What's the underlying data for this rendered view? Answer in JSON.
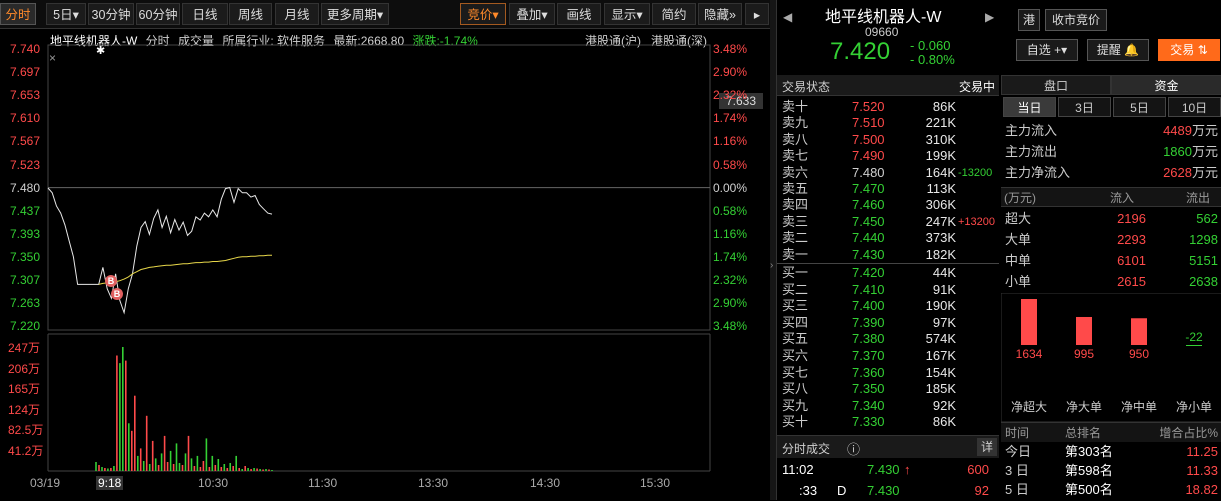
{
  "toolbar": {
    "tabs": [
      "分时",
      "5日",
      "30分钟",
      "60分钟",
      "日线",
      "周线",
      "月线",
      "更多周期"
    ],
    "dropdown_arrow": "▾",
    "right": [
      "竞价",
      "叠加",
      "画线",
      "显示",
      "简约",
      "隐藏"
    ],
    "expand": "»"
  },
  "chart": {
    "info": {
      "name": "地平线机器人-W",
      "mode": "分时",
      "volume": "成交量",
      "industry": "所属行业: 软件服务",
      "latest": "最新:2668.80",
      "change": "涨跌:-1.74%",
      "hk_sh": "港股通(沪)",
      "hk_sz": "港股通(深)"
    },
    "close_mark": "×",
    "star_mark": "✱",
    "y_price": [
      "7.740",
      "7.697",
      "7.653",
      "7.610",
      "7.567",
      "7.523",
      "7.480",
      "7.437",
      "7.393",
      "7.350",
      "7.307",
      "7.263",
      "7.220"
    ],
    "y_pct": [
      "3.48%",
      "2.90%",
      "2.32%",
      "1.74%",
      "1.16%",
      "0.58%",
      "0.00%",
      "0.58%",
      "1.16%",
      "1.74%",
      "2.32%",
      "2.90%",
      "3.48%"
    ],
    "cursor_price": "7.633",
    "y_vol": [
      "247万",
      "206万",
      "165万",
      "124万",
      "82.5万",
      "41.2万"
    ],
    "x_labels": [
      "03/19",
      "9:18",
      "10:30",
      "11:30",
      "13:30",
      "14:30",
      "15:30"
    ],
    "marker_b": "B",
    "chart_data": {
      "type": "line",
      "title": "",
      "ylim": [
        7.22,
        7.74
      ],
      "prev_close": 7.48,
      "series": [
        {
          "values": [
            7.479,
            7.47,
            7.445,
            7.432,
            7.41,
            7.38,
            7.35,
            7.298,
            7.298,
            7.298,
            7.298,
            7.298,
            7.298,
            7.33,
            7.29,
            7.272,
            7.318,
            7.268,
            7.245,
            7.29,
            7.318,
            7.37,
            7.405,
            7.416,
            7.392,
            7.422,
            7.438,
            7.405,
            7.426,
            7.395,
            7.42,
            7.4,
            7.415,
            7.39,
            7.398,
            7.425,
            7.419,
            7.432,
            7.425,
            7.438,
            7.425,
            7.458,
            7.478,
            7.48,
            7.452,
            7.478,
            7.47,
            7.47,
            7.462,
            7.465,
            7.448,
            7.44,
            7.432,
            7.43
          ]
        },
        {
          "values": [
            null,
            null,
            null,
            null,
            null,
            null,
            null,
            null,
            null,
            null,
            null,
            null,
            7.298,
            7.3,
            7.301,
            7.302,
            7.303,
            7.305,
            7.308,
            7.312,
            7.318,
            7.322,
            7.326,
            7.328,
            7.33,
            7.331,
            7.332,
            7.333,
            7.334,
            7.334,
            7.335,
            7.336,
            7.337,
            7.337,
            7.338,
            7.339,
            7.339,
            7.34,
            7.34,
            7.341,
            7.341,
            7.342,
            7.343,
            7.345,
            7.347,
            7.349,
            7.35,
            7.35,
            7.351,
            7.351,
            7.352,
            7.352,
            7.353,
            7.353
          ]
        }
      ],
      "volume": [
        18,
        12,
        8,
        6,
        5,
        6,
        10,
        230,
        215,
        247,
        220,
        95,
        80,
        150,
        30,
        45,
        20,
        110,
        14,
        60,
        25,
        12,
        35,
        70,
        18,
        40,
        14,
        55,
        16,
        12,
        35,
        70,
        25,
        10,
        30,
        8,
        20,
        65,
        8,
        30,
        12,
        24,
        8,
        14,
        6,
        16,
        10,
        30,
        6,
        4,
        10,
        6,
        4,
        6,
        5,
        4,
        3,
        4,
        3,
        2
      ],
      "volume_colors": [
        "#34d034",
        "#ff4a4a",
        "#34d034",
        "#ff4a4a",
        "#34d034",
        "#ff4a4a",
        "#34d034",
        "#ff4a4a",
        "#34d034",
        "#34d034",
        "#ff4a4a",
        "#34d034",
        "#ff4a4a",
        "#ff4a4a",
        "#34d034",
        "#ff4a4a",
        "#34d034",
        "#ff4a4a",
        "#34d034",
        "#ff4a4a",
        "#34d034",
        "#ff4a4a",
        "#34d034",
        "#ff4a4a",
        "#ff4a4a",
        "#34d034",
        "#ff4a4a",
        "#34d034",
        "#34d034",
        "#ff4a4a",
        "#34d034",
        "#ff4a4a",
        "#34d034",
        "#ff4a4a",
        "#34d034",
        "#ff4a4a",
        "#ff4a4a",
        "#34d034",
        "#ff4a4a",
        "#34d034",
        "#ff4a4a",
        "#34d034",
        "#ff4a4a",
        "#34d034",
        "#ff4a4a",
        "#34d034",
        "#ff4a4a",
        "#34d034",
        "#ff4a4a",
        "#34d034",
        "#ff4a4a",
        "#34d034",
        "#ff4a4a",
        "#34d034",
        "#ff4a4a",
        "#34d034",
        "#ff4a4a",
        "#34d034",
        "#ff4a4a",
        "#34d034"
      ]
    }
  },
  "stock": {
    "title": "地平线机器人-W",
    "code": "09660",
    "price": "7.420",
    "change": "- 0.060",
    "change_pct": "- 0.80%",
    "hk": "港",
    "auction": "收市竞价",
    "watch": "自选",
    "watch_plus": "+",
    "reminder": "提醒",
    "trade": "交易",
    "trade_icon": "⇅",
    "nav_prev": "◀",
    "nav_next": "▶"
  },
  "orderbook": {
    "status_label": "交易状态",
    "status": "交易中",
    "asks": [
      {
        "l": "卖十",
        "p": "7.520",
        "v": "86K",
        "c": ""
      },
      {
        "l": "卖九",
        "p": "7.510",
        "v": "221K",
        "c": ""
      },
      {
        "l": "卖八",
        "p": "7.500",
        "v": "310K",
        "c": ""
      },
      {
        "l": "卖七",
        "p": "7.490",
        "v": "199K",
        "c": ""
      },
      {
        "l": "卖六",
        "p": "7.480",
        "v": "164K",
        "c": "-13200"
      },
      {
        "l": "卖五",
        "p": "7.470",
        "v": "113K",
        "c": ""
      },
      {
        "l": "卖四",
        "p": "7.460",
        "v": "306K",
        "c": ""
      },
      {
        "l": "卖三",
        "p": "7.450",
        "v": "247K",
        "c": "+13200"
      },
      {
        "l": "卖二",
        "p": "7.440",
        "v": "373K",
        "c": ""
      },
      {
        "l": "卖一",
        "p": "7.430",
        "v": "182K",
        "c": ""
      }
    ],
    "bids": [
      {
        "l": "买一",
        "p": "7.420",
        "v": "44K"
      },
      {
        "l": "买二",
        "p": "7.410",
        "v": "91K"
      },
      {
        "l": "买三",
        "p": "7.400",
        "v": "190K"
      },
      {
        "l": "买四",
        "p": "7.390",
        "v": "97K"
      },
      {
        "l": "买五",
        "p": "7.380",
        "v": "574K"
      },
      {
        "l": "买六",
        "p": "7.370",
        "v": "167K"
      },
      {
        "l": "买七",
        "p": "7.360",
        "v": "154K"
      },
      {
        "l": "买八",
        "p": "7.350",
        "v": "185K"
      },
      {
        "l": "买九",
        "p": "7.340",
        "v": "92K"
      },
      {
        "l": "买十",
        "p": "7.330",
        "v": "86K"
      }
    ],
    "ticks_label": "分时成交",
    "ticks_info": "ⓘ",
    "detail": "详",
    "ticks": [
      {
        "time": "11:02",
        "flag": "",
        "price": "7.430",
        "arrow": "↑",
        "vol": "600"
      },
      {
        "time": ":33",
        "flag": "D",
        "price": "7.430",
        "arrow": "",
        "vol": "92"
      }
    ]
  },
  "capital": {
    "tabs": [
      "盘口",
      "资金"
    ],
    "periods": [
      "当日",
      "3日",
      "5日",
      "10日"
    ],
    "flows": [
      {
        "label": "主力流入",
        "value": "4489",
        "unit": "万元",
        "color": "#ff4a4a"
      },
      {
        "label": "主力流出",
        "value": "1860",
        "unit": "万元",
        "color": "#34d034"
      },
      {
        "label": "主力净流入",
        "value": "2628",
        "unit": "万元",
        "color": "#ff4a4a"
      }
    ],
    "table_head": [
      "(万元)",
      "流入",
      "流出"
    ],
    "sizes": [
      {
        "label": "超大",
        "in": "2196",
        "out": "562"
      },
      {
        "label": "大单",
        "in": "2293",
        "out": "1298"
      },
      {
        "label": "中单",
        "in": "6101",
        "out": "5151"
      },
      {
        "label": "小单",
        "in": "2615",
        "out": "2638"
      }
    ],
    "net_chart": {
      "type": "bar",
      "categories": [
        "净超大",
        "净大单",
        "净中单",
        "净小单"
      ],
      "values": [
        1634,
        995,
        950,
        -22
      ],
      "labels": [
        "1634",
        "995",
        "950",
        "-22"
      ]
    },
    "rank_head": [
      "时间",
      "总排名",
      "增合占比%"
    ],
    "ranks": [
      {
        "period": "今日",
        "rank": "第303名",
        "pct": "11.25"
      },
      {
        "period": "3 日",
        "rank": "第598名",
        "pct": "11.33"
      },
      {
        "period": "5 日",
        "rank": "第500名",
        "pct": "18.82"
      }
    ]
  }
}
